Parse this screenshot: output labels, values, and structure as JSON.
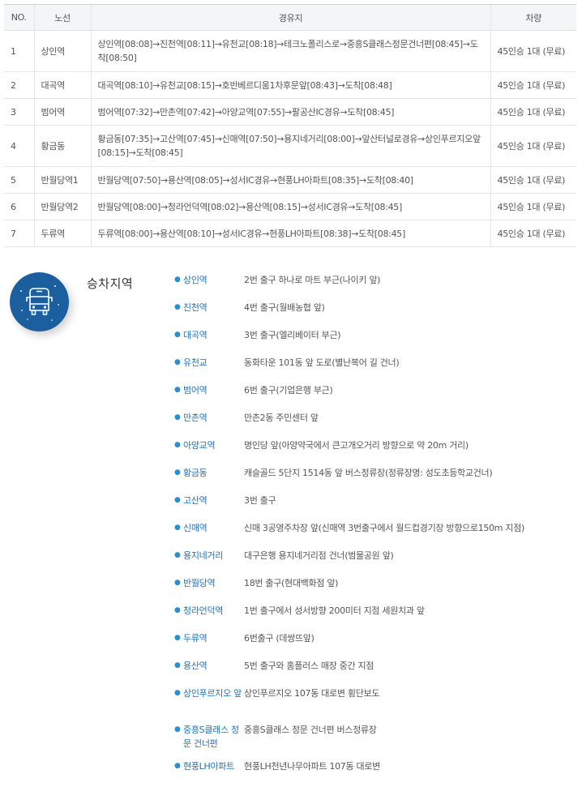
{
  "table": {
    "headers": {
      "no": "NO.",
      "line": "노선",
      "stops": "경유지",
      "vehicle": "차량"
    },
    "rows": [
      {
        "no": "1",
        "line": "상인역",
        "route": "상인역[08:08]→진천역[08:11]→유천교[08:18]→테크노폴리스로→중흥S클래스정문건너편[08:45]→도착[08:50]",
        "vehicle": "45인승 1대 (무료)"
      },
      {
        "no": "2",
        "line": "대곡역",
        "route": "대곡역[08:10]→유천교[08:15]→호반베르디움1차후문앞[08:43]→도착[08:48]",
        "vehicle": "45인승 1대 (무료)"
      },
      {
        "no": "3",
        "line": "범어역",
        "route": "범어역[07:32]→만촌역[07:42]→아양교역[07:55]→팔공산IC경유→도착[08:45]",
        "vehicle": "45인승 1대 (무료)"
      },
      {
        "no": "4",
        "line": "황금동",
        "route": "황금동[07:35]→고산역[07:45]→신매역[07:50]→용지네거리[08:00]→앞산터널로경유→상인푸르지오앞[08:15]→도착[08:45]",
        "vehicle": "45인승 1대 (무료)"
      },
      {
        "no": "5",
        "line": "반월당역1",
        "route": "반월당역[07:50]→용산역[08:05]→성서IC경유→현풍LH아파트[08:35]→도착[08:40]",
        "vehicle": "45인승 1대 (무료)"
      },
      {
        "no": "6",
        "line": "반월당역2",
        "route": "반월당역[08:00]→청라언덕역[08:02]→용산역[08:15]→성서IC경유→도착[08:45]",
        "vehicle": "45인승 1대 (무료)"
      },
      {
        "no": "7",
        "line": "두류역",
        "route": "두류역[08:00]→용산역[08:10]→성서IC경유→현풍LH아파트[08:38]→도착[08:45]",
        "vehicle": "45인승 1대 (무료)"
      }
    ]
  },
  "boarding": {
    "title": "승차지역",
    "icon": "bus-icon",
    "accent_color": "#1c5f9f",
    "stops": [
      {
        "name": "상인역",
        "desc": "2번 출구 하나로 마트 부근(나이키 앞)"
      },
      {
        "name": "진천역",
        "desc": "4번 출구(월배농협 앞)"
      },
      {
        "name": "대곡역",
        "desc": "3번 출구(엘리베이터 부근)"
      },
      {
        "name": "유천교",
        "desc": "동화타운 101동 앞 도로(별난복어 길 건너)"
      },
      {
        "name": "범어역",
        "desc": "6번 출구(기업은행 부근)"
      },
      {
        "name": "만촌역",
        "desc": "만촌2동 주민센터 앞"
      },
      {
        "name": "아양교역",
        "desc": "명인당 앞(아양약국에서 큰고개오거리 방향으로 약 20m 거리)"
      },
      {
        "name": "황금동",
        "desc": "캐슬골드 5단지 1514동 앞 버스정류장(정류장명: 성도초등학교건너)"
      },
      {
        "name": "고산역",
        "desc": "3번 출구"
      },
      {
        "name": "신매역",
        "desc": "신매 3공영주차장 앞(신매역 3번출구에서 월드컵경기장 방향으로150m 지점)"
      },
      {
        "name": "용지네거리",
        "desc": "대구은행 용지네거리점 건너(범물공원 앞)"
      },
      {
        "name": "반월당역",
        "desc": "18번 출구(현대백화점 앞)"
      },
      {
        "name": "청라언덕역",
        "desc": "1번 출구에서 성서방향 200미터 지점 세원치과 앞"
      },
      {
        "name": "두류역",
        "desc": "6번출구 (데쌍뜨앞)"
      },
      {
        "name": "용산역",
        "desc": "5번 출구와 홈플러스 매장 중간 지점"
      },
      {
        "name": "상인푸르지오 앞",
        "desc": "상인푸르지오 107동 대로변 횡단보도"
      },
      {
        "name": "중흥S클래스 정문 건너편",
        "desc": "중흥S클래스 정문 건너편 버스정류장"
      },
      {
        "name": "현풍LH아파트",
        "desc": "현풍LH천년나무아파트 107동 대로변"
      }
    ]
  }
}
